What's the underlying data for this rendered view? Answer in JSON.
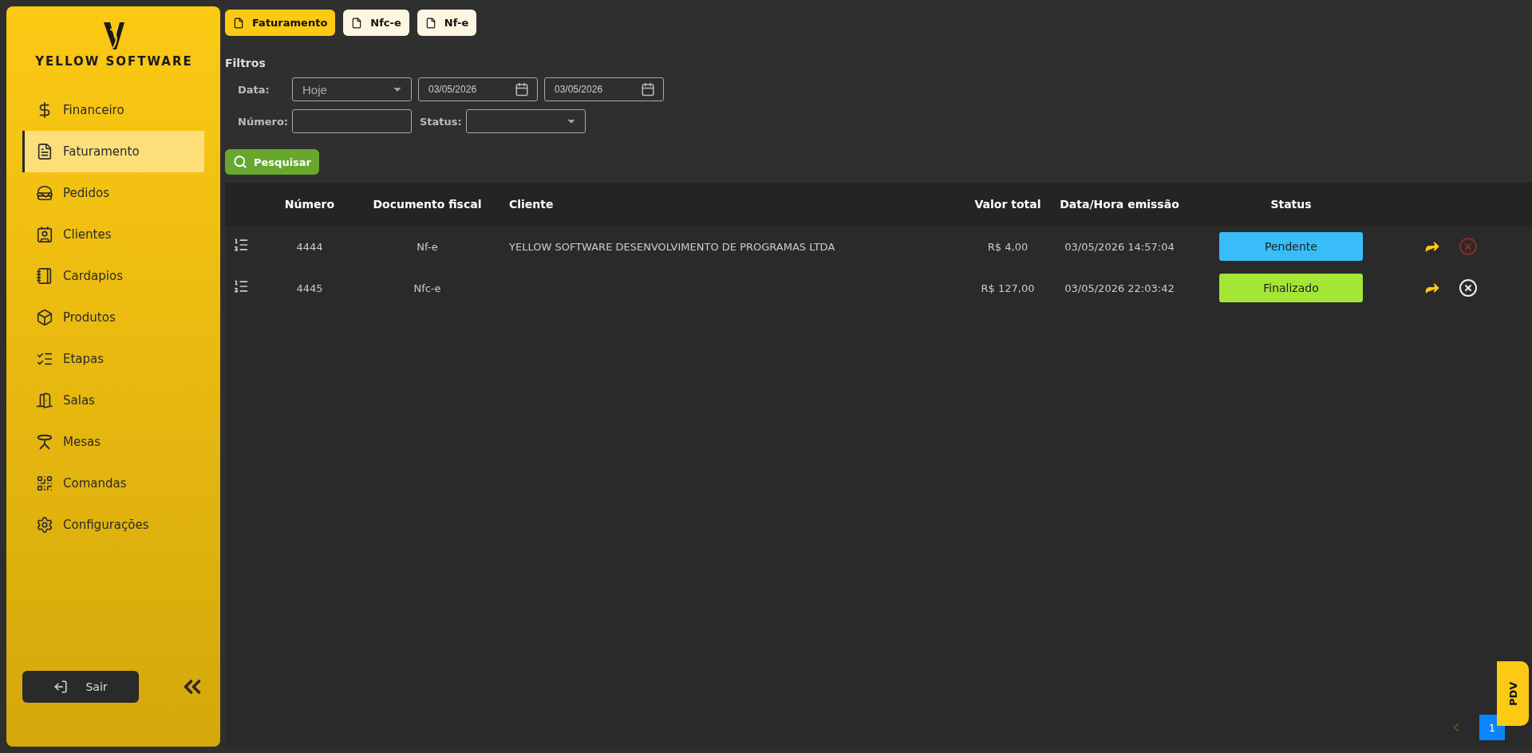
{
  "sidebar": {
    "brand": "YELLOW SOFTWARE",
    "items": [
      {
        "label": "Financeiro",
        "selected": false
      },
      {
        "label": "Faturamento",
        "selected": true
      },
      {
        "label": "Pedidos",
        "selected": false
      },
      {
        "label": "Clientes",
        "selected": false
      },
      {
        "label": "Cardapios",
        "selected": false
      },
      {
        "label": "Produtos",
        "selected": false
      },
      {
        "label": "Etapas",
        "selected": false
      },
      {
        "label": "Salas",
        "selected": false
      },
      {
        "label": "Mesas",
        "selected": false
      },
      {
        "label": "Comandas",
        "selected": false
      },
      {
        "label": "Configurações",
        "selected": false
      }
    ],
    "logout": "Sair"
  },
  "tabs": [
    {
      "label": "Faturamento",
      "selected": true
    },
    {
      "label": "Nfc-e",
      "selected": false
    },
    {
      "label": "Nf-e",
      "selected": false
    }
  ],
  "filters": {
    "title": "Filtros",
    "date_label": "Data:",
    "date_range": "Hoje",
    "date_from": "03/05/2026",
    "date_to": "03/05/2026",
    "number_label": "Número:",
    "status_label": "Status:",
    "search_button": "Pesquisar"
  },
  "table": {
    "columns": [
      "Número",
      "Documento fiscal",
      "Cliente",
      "Valor total",
      "Data/Hora emissão",
      "Status"
    ],
    "rows": [
      {
        "numero": "4444",
        "documento": "Nf-e",
        "cliente": "YELLOW SOFTWARE DESENVOLVIMENTO DE PROGRAMAS LTDA",
        "valor": "R$ 4,00",
        "data_hora": "03/05/2026 14:57:04",
        "status": "Pendente",
        "color": "#38bdf8",
        "cancel_disabled": true
      },
      {
        "numero": "4445",
        "documento": "Nfc-e",
        "valor": "R$ 127,00",
        "data_hora": "03/05/2026 22:03:42",
        "status": "Finalizado",
        "color": "#a3e635",
        "cancel_disabled": false
      }
    ]
  },
  "pagination": {
    "prev_disabled": true,
    "pages": [
      {
        "label": "1",
        "selected": true
      }
    ]
  },
  "pdv_tab": "PDV"
}
